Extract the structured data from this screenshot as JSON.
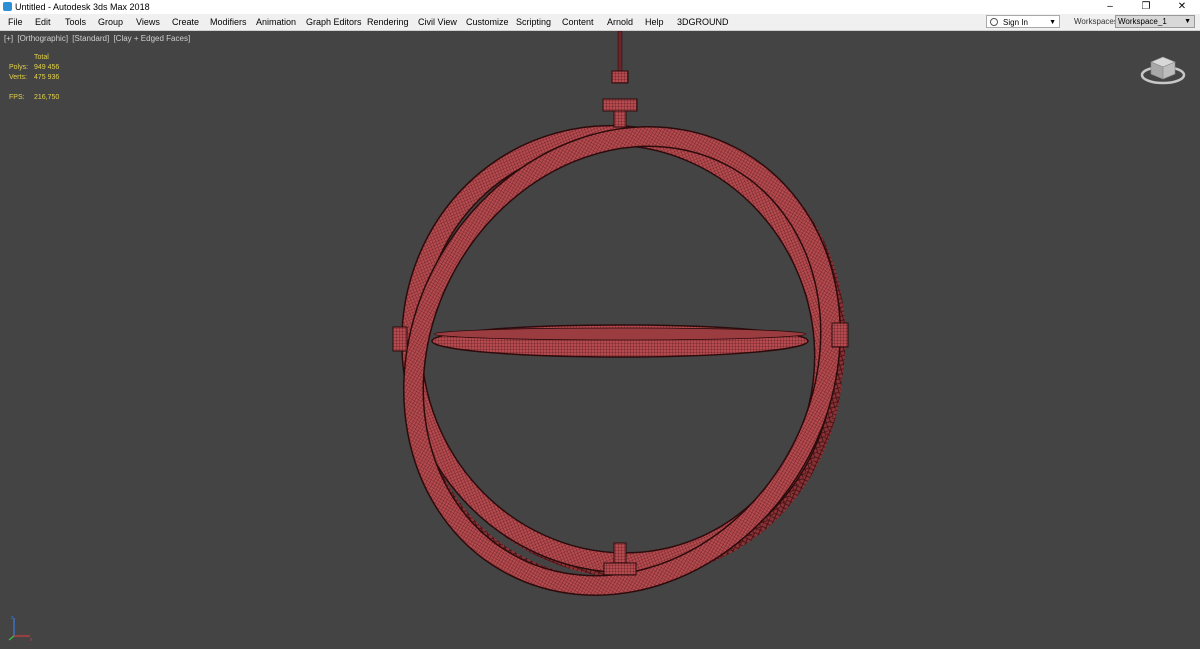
{
  "window": {
    "title": "Untitled - Autodesk 3ds Max 2018"
  },
  "menu": [
    "File",
    "Edit",
    "Tools",
    "Group",
    "Views",
    "Create",
    "Modifiers",
    "Animation",
    "Graph Editors",
    "Rendering",
    "Civil View",
    "Customize",
    "Scripting",
    "Content",
    "Arnold",
    "Help",
    "3DGROUND"
  ],
  "signin": {
    "label": "Sign In",
    "icon": "user-icon"
  },
  "workspaces": {
    "label": "Workspaces:",
    "value": "Workspace_1"
  },
  "viewport": {
    "labels": [
      "[+]",
      "[Orthographic]",
      "[Standard]",
      "[Clay + Edged Faces]"
    ],
    "stats": {
      "header": "Total",
      "polys_label": "Polys:",
      "polys": "949 456",
      "verts_label": "Verts:",
      "verts": "475 936",
      "fps_label": "FPS:",
      "fps": "216,750"
    }
  },
  "colors": {
    "model": "#b54a4f",
    "edges": "#4a1416",
    "stats": "#e3d24a",
    "background": "#444444"
  }
}
